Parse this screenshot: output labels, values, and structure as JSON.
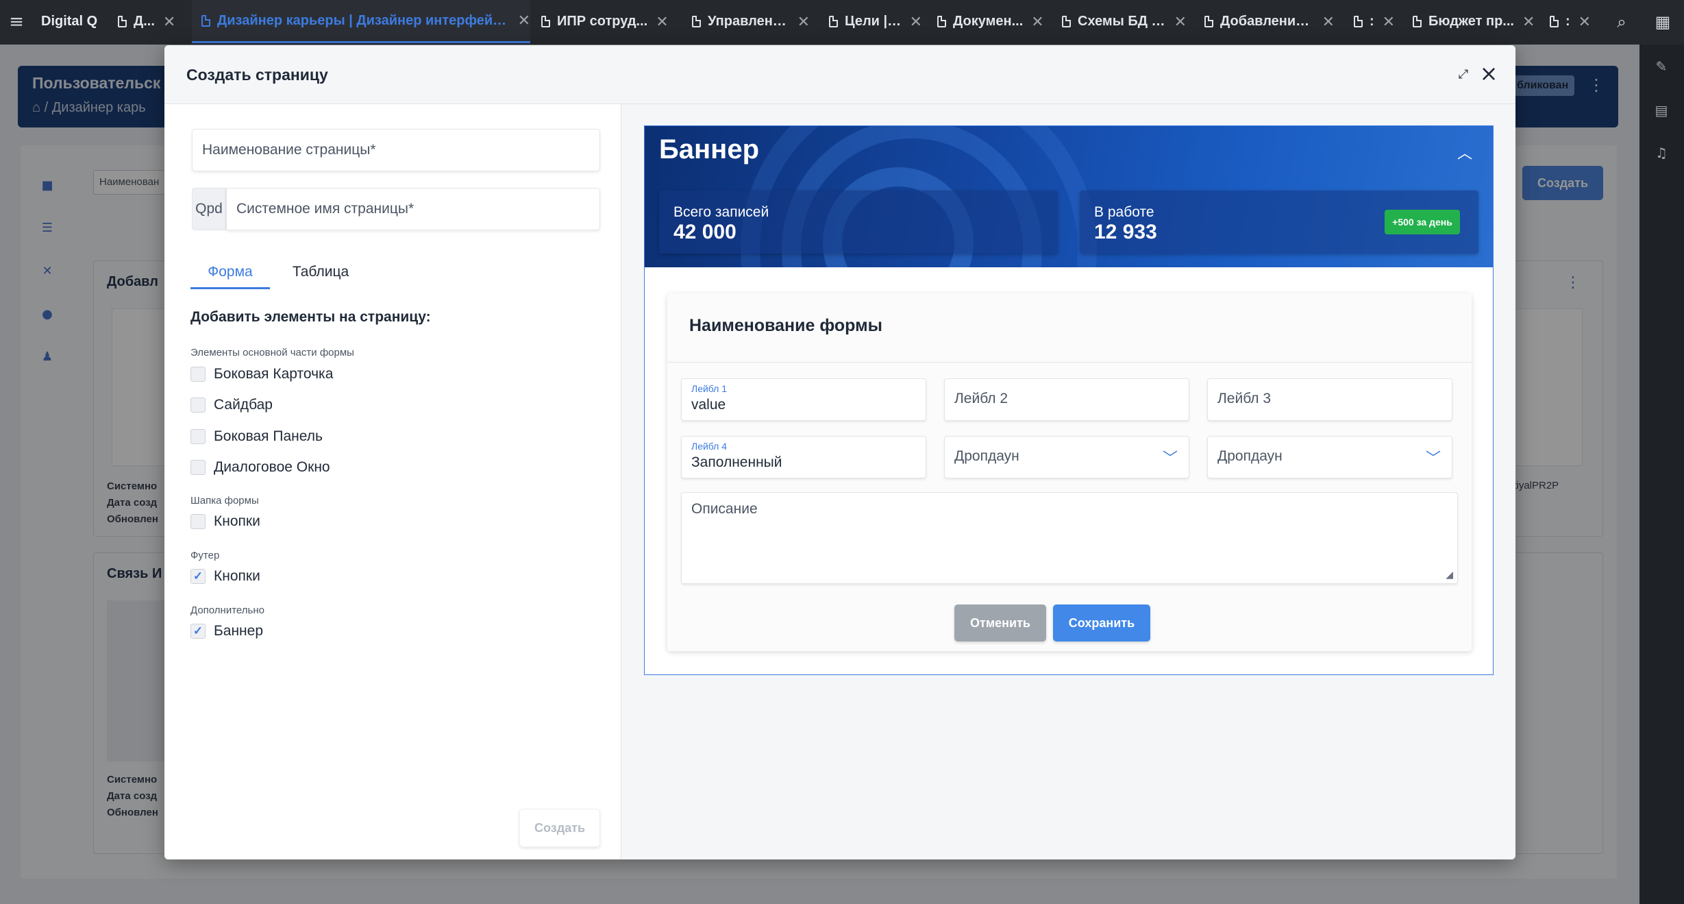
{
  "topbar": {
    "brand": "Digital Q",
    "tabs": [
      {
        "label": "Д..."
      },
      {
        "label": "Дизайнер карьеры | Дизайнер интерфейсов",
        "active": true
      },
      {
        "label": "ИПР сотруд..."
      },
      {
        "label": "Управлени..."
      },
      {
        "label": "Цели | ..."
      },
      {
        "label": "Докумен..."
      },
      {
        "label": "Схемы БД в..."
      },
      {
        "label": "Добавление..."
      },
      {
        "label": ":"
      },
      {
        "label": "Бюджет пр..."
      },
      {
        "label": ":"
      }
    ],
    "icons": [
      "menu-icon",
      "search-icon",
      "apps-grid-icon"
    ]
  },
  "background": {
    "title": "Пользовательск",
    "breadcrumb": "/ Дизайнер карь",
    "status_pill": "бликован",
    "search_placeholder": "Наименован",
    "create_button": "Создать",
    "section1_title": "Добавл",
    "section2_title": "Связь И",
    "meta_lines": [
      "Системно",
      "Дата созд",
      "Обновлен"
    ],
    "right_item_text": "itiyalPR2P"
  },
  "modal": {
    "title": "Создать страницу",
    "page_name_placeholder": "Наименование страницы*",
    "prefix": "Qpd",
    "system_name_placeholder": "Системное имя страницы*",
    "tabs": [
      "Форма",
      "Таблица"
    ],
    "add_title": "Добавить элементы на страницу:",
    "groups": [
      {
        "title": "Элементы основной части формы",
        "items": [
          {
            "label": "Боковая Карточка",
            "checked": false
          },
          {
            "label": "Сайдбар",
            "checked": false
          },
          {
            "label": "Боковая Панель",
            "checked": false
          },
          {
            "label": "Диалоговое Окно",
            "checked": false
          }
        ]
      },
      {
        "title": "Шапка формы",
        "items": [
          {
            "label": "Кнопки",
            "checked": false
          }
        ]
      },
      {
        "title": "Футер",
        "items": [
          {
            "label": "Кнопки",
            "checked": true
          }
        ]
      },
      {
        "title": "Дополнительно",
        "items": [
          {
            "label": "Баннер",
            "checked": true
          }
        ]
      }
    ],
    "create_button": "Создать"
  },
  "preview": {
    "banner": {
      "title": "Баннер",
      "stats": [
        {
          "label": "Всего записей",
          "value": "42 000"
        },
        {
          "label": "В работе",
          "value": "12 933",
          "badge": "+500 за день"
        }
      ]
    },
    "form": {
      "title": "Наименование формы",
      "fields": [
        {
          "label": "Лейбл 1",
          "value": "value"
        },
        {
          "placeholder": "Лейбл 2"
        },
        {
          "placeholder": "Лейбл 3"
        },
        {
          "label": "Лейбл 4",
          "value": "Заполненный"
        },
        {
          "placeholder": "Дропдаун",
          "type": "dropdown"
        },
        {
          "placeholder": "Дропдаун",
          "type": "dropdown"
        }
      ],
      "description_placeholder": "Описание",
      "cancel_button": "Отменить",
      "save_button": "Сохранить"
    }
  },
  "colors": {
    "accent": "#3d7be0",
    "banner": "#1447a3",
    "badge": "#22b14c",
    "topbar": "#25282d"
  }
}
